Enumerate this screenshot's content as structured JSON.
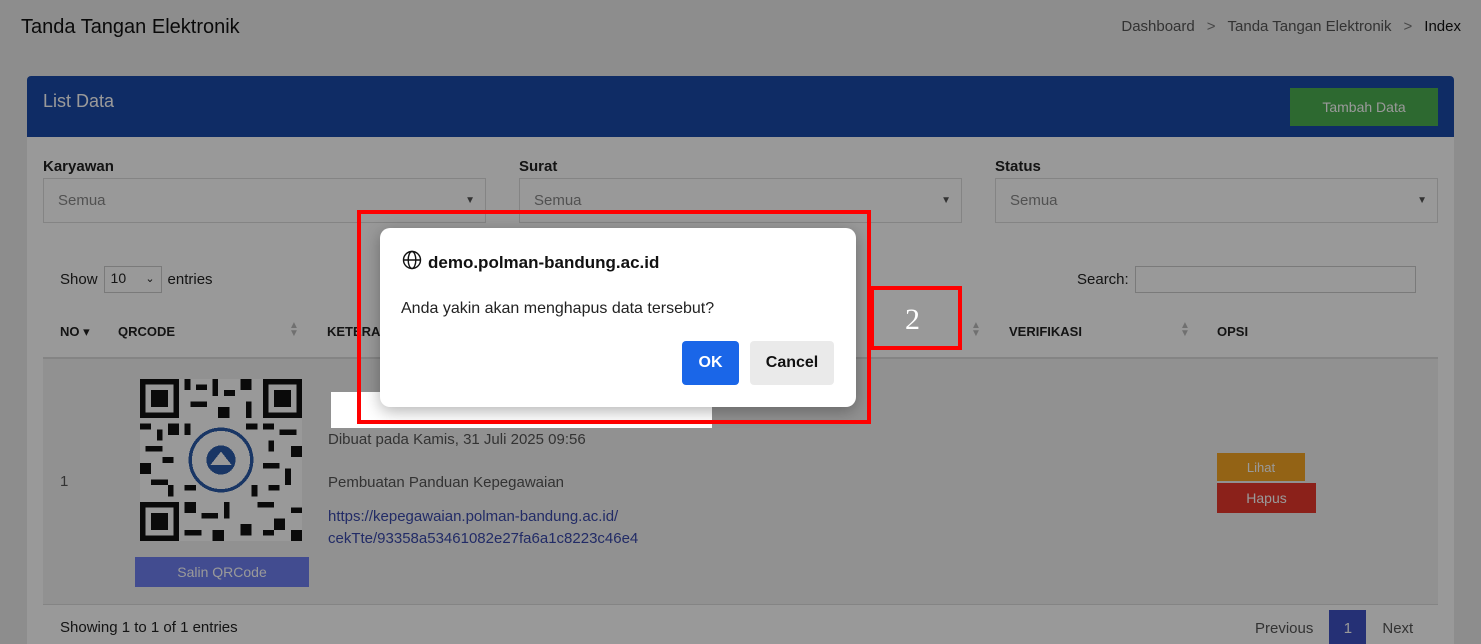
{
  "header": {
    "title": "Tanda Tangan Elektronik",
    "breadcrumb": [
      "Dashboard",
      "Tanda Tangan Elektronik",
      "Index"
    ],
    "separator": ">"
  },
  "card": {
    "title": "List Data",
    "add_button": "Tambah Data"
  },
  "filters": {
    "karyawan": {
      "label": "Karyawan",
      "value": "Semua"
    },
    "surat": {
      "label": "Surat",
      "value": "Semua"
    },
    "status": {
      "label": "Status",
      "value": "Semua"
    }
  },
  "table_controls": {
    "show_label": "Show",
    "entries_value": "10",
    "entries_label": "entries",
    "search_label": "Search:"
  },
  "columns": {
    "no": "NO",
    "qrcode": "QRCODE",
    "keterangan": "KETERAN",
    "verifikasi": "VERIFIKASI",
    "opsi": "OPSI"
  },
  "rows": [
    {
      "no": "1",
      "copy_button": "Salin QRCode",
      "created": "Dibuat pada Kamis, 31 Juli 2025 09:56",
      "description": "Pembuatan Panduan Kepegawaian",
      "link_line1": "https://kepegawaian.polman-bandung.ac.id/",
      "link_line2": "cekTte/93358a53461082e27fa6a1c8223c46e4",
      "view_button": "Lihat",
      "delete_button": "Hapus"
    }
  ],
  "footer": {
    "info": "Showing 1 to 1 of 1 entries",
    "prev": "Previous",
    "page": "1",
    "next": "Next"
  },
  "dialog": {
    "origin": "demo.polman-bandung.ac.id",
    "message": "Anda yakin akan menghapus data tersebut?",
    "ok": "OK",
    "cancel": "Cancel"
  },
  "annotation": {
    "label": "2",
    "color": "#ff0000"
  }
}
